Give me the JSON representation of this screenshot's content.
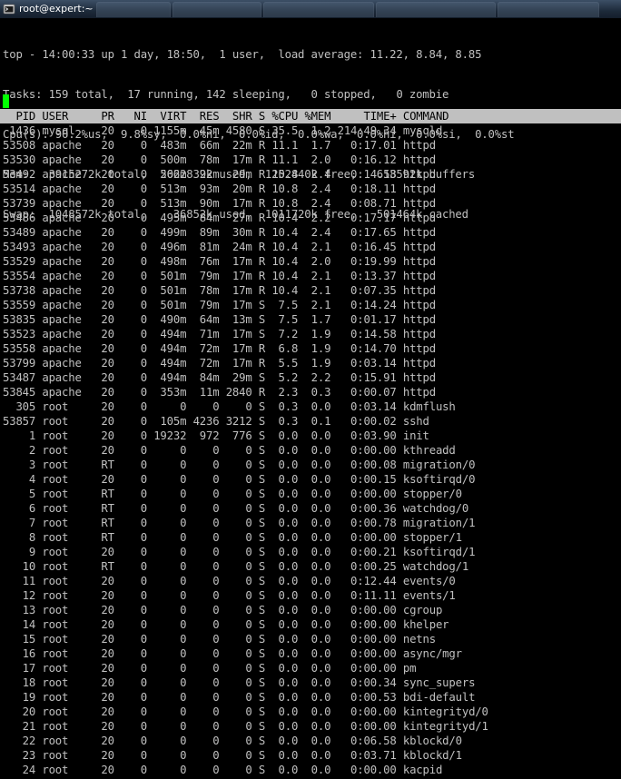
{
  "window": {
    "title": "root@expert:~"
  },
  "summary": [
    "top - 14:00:33 up 1 day, 18:50,  1 user,  load average: 11.22, 8.84, 8.85",
    "Tasks: 159 total,  17 running, 142 sleeping,   0 stopped,   0 zombie",
    "Cpu(s): 90.2%us,  9.8%sy,  0.0%ni,  0.0%id,  0.0%wa,  0.0%hi,  0.0%si,  0.0%st",
    "Mem:   3915272k total,  2662832k used,  1252440k free,   613592k buffers",
    "Swap:  1048572k total,    36852k used,  1011720k free,   501464k cached"
  ],
  "table": {
    "columns": [
      "PID",
      "USER",
      "PR",
      "NI",
      "VIRT",
      "RES",
      "SHR",
      "S",
      "%CPU",
      "%MEM",
      "TIME+",
      "COMMAND"
    ],
    "rows": [
      [
        "1436",
        "mysql",
        "20",
        "0",
        "1155m",
        "45m",
        "4580",
        "S",
        "35.5",
        "1.2",
        "214:49.34",
        "mysqld"
      ],
      [
        "53508",
        "apache",
        "20",
        "0",
        "483m",
        "66m",
        "22m",
        "R",
        "11.1",
        "1.7",
        "0:17.01",
        "httpd"
      ],
      [
        "53530",
        "apache",
        "20",
        "0",
        "500m",
        "78m",
        "17m",
        "R",
        "11.1",
        "2.0",
        "0:16.12",
        "httpd"
      ],
      [
        "53492",
        "apache",
        "20",
        "0",
        "502m",
        "92m",
        "29m",
        "R",
        "10.8",
        "2.4",
        "0:14.58",
        "httpd"
      ],
      [
        "53514",
        "apache",
        "20",
        "0",
        "513m",
        "93m",
        "20m",
        "R",
        "10.8",
        "2.4",
        "0:18.11",
        "httpd"
      ],
      [
        "53739",
        "apache",
        "20",
        "0",
        "513m",
        "90m",
        "17m",
        "R",
        "10.8",
        "2.4",
        "0:08.71",
        "httpd"
      ],
      [
        "53486",
        "apache",
        "20",
        "0",
        "495m",
        "84m",
        "27m",
        "R",
        "10.4",
        "2.2",
        "0:17.17",
        "httpd"
      ],
      [
        "53489",
        "apache",
        "20",
        "0",
        "499m",
        "89m",
        "30m",
        "R",
        "10.4",
        "2.4",
        "0:17.65",
        "httpd"
      ],
      [
        "53493",
        "apache",
        "20",
        "0",
        "496m",
        "81m",
        "24m",
        "R",
        "10.4",
        "2.1",
        "0:16.45",
        "httpd"
      ],
      [
        "53529",
        "apache",
        "20",
        "0",
        "498m",
        "76m",
        "17m",
        "R",
        "10.4",
        "2.0",
        "0:19.99",
        "httpd"
      ],
      [
        "53554",
        "apache",
        "20",
        "0",
        "501m",
        "79m",
        "17m",
        "R",
        "10.4",
        "2.1",
        "0:13.37",
        "httpd"
      ],
      [
        "53738",
        "apache",
        "20",
        "0",
        "501m",
        "78m",
        "17m",
        "R",
        "10.4",
        "2.1",
        "0:07.35",
        "httpd"
      ],
      [
        "53559",
        "apache",
        "20",
        "0",
        "501m",
        "79m",
        "17m",
        "S",
        "7.5",
        "2.1",
        "0:14.24",
        "httpd"
      ],
      [
        "53835",
        "apache",
        "20",
        "0",
        "490m",
        "64m",
        "13m",
        "S",
        "7.5",
        "1.7",
        "0:01.17",
        "httpd"
      ],
      [
        "53523",
        "apache",
        "20",
        "0",
        "494m",
        "71m",
        "17m",
        "S",
        "7.2",
        "1.9",
        "0:14.58",
        "httpd"
      ],
      [
        "53558",
        "apache",
        "20",
        "0",
        "494m",
        "72m",
        "17m",
        "R",
        "6.8",
        "1.9",
        "0:14.70",
        "httpd"
      ],
      [
        "53799",
        "apache",
        "20",
        "0",
        "494m",
        "72m",
        "17m",
        "R",
        "5.5",
        "1.9",
        "0:03.14",
        "httpd"
      ],
      [
        "53487",
        "apache",
        "20",
        "0",
        "494m",
        "84m",
        "29m",
        "S",
        "5.2",
        "2.2",
        "0:15.91",
        "httpd"
      ],
      [
        "53845",
        "apache",
        "20",
        "0",
        "353m",
        "11m",
        "2840",
        "R",
        "2.3",
        "0.3",
        "0:00.07",
        "httpd"
      ],
      [
        "305",
        "root",
        "20",
        "0",
        "0",
        "0",
        "0",
        "S",
        "0.3",
        "0.0",
        "0:03.14",
        "kdmflush"
      ],
      [
        "53857",
        "root",
        "20",
        "0",
        "105m",
        "4236",
        "3212",
        "S",
        "0.3",
        "0.1",
        "0:00.02",
        "sshd"
      ],
      [
        "1",
        "root",
        "20",
        "0",
        "19232",
        "972",
        "776",
        "S",
        "0.0",
        "0.0",
        "0:03.90",
        "init"
      ],
      [
        "2",
        "root",
        "20",
        "0",
        "0",
        "0",
        "0",
        "S",
        "0.0",
        "0.0",
        "0:00.00",
        "kthreadd"
      ],
      [
        "3",
        "root",
        "RT",
        "0",
        "0",
        "0",
        "0",
        "S",
        "0.0",
        "0.0",
        "0:00.08",
        "migration/0"
      ],
      [
        "4",
        "root",
        "20",
        "0",
        "0",
        "0",
        "0",
        "S",
        "0.0",
        "0.0",
        "0:00.15",
        "ksoftirqd/0"
      ],
      [
        "5",
        "root",
        "RT",
        "0",
        "0",
        "0",
        "0",
        "S",
        "0.0",
        "0.0",
        "0:00.00",
        "stopper/0"
      ],
      [
        "6",
        "root",
        "RT",
        "0",
        "0",
        "0",
        "0",
        "S",
        "0.0",
        "0.0",
        "0:00.36",
        "watchdog/0"
      ],
      [
        "7",
        "root",
        "RT",
        "0",
        "0",
        "0",
        "0",
        "S",
        "0.0",
        "0.0",
        "0:00.78",
        "migration/1"
      ],
      [
        "8",
        "root",
        "RT",
        "0",
        "0",
        "0",
        "0",
        "S",
        "0.0",
        "0.0",
        "0:00.00",
        "stopper/1"
      ],
      [
        "9",
        "root",
        "20",
        "0",
        "0",
        "0",
        "0",
        "S",
        "0.0",
        "0.0",
        "0:00.21",
        "ksoftirqd/1"
      ],
      [
        "10",
        "root",
        "RT",
        "0",
        "0",
        "0",
        "0",
        "S",
        "0.0",
        "0.0",
        "0:00.25",
        "watchdog/1"
      ],
      [
        "11",
        "root",
        "20",
        "0",
        "0",
        "0",
        "0",
        "S",
        "0.0",
        "0.0",
        "0:12.44",
        "events/0"
      ],
      [
        "12",
        "root",
        "20",
        "0",
        "0",
        "0",
        "0",
        "S",
        "0.0",
        "0.0",
        "0:11.11",
        "events/1"
      ],
      [
        "13",
        "root",
        "20",
        "0",
        "0",
        "0",
        "0",
        "S",
        "0.0",
        "0.0",
        "0:00.00",
        "cgroup"
      ],
      [
        "14",
        "root",
        "20",
        "0",
        "0",
        "0",
        "0",
        "S",
        "0.0",
        "0.0",
        "0:00.00",
        "khelper"
      ],
      [
        "15",
        "root",
        "20",
        "0",
        "0",
        "0",
        "0",
        "S",
        "0.0",
        "0.0",
        "0:00.00",
        "netns"
      ],
      [
        "16",
        "root",
        "20",
        "0",
        "0",
        "0",
        "0",
        "S",
        "0.0",
        "0.0",
        "0:00.00",
        "async/mgr"
      ],
      [
        "17",
        "root",
        "20",
        "0",
        "0",
        "0",
        "0",
        "S",
        "0.0",
        "0.0",
        "0:00.00",
        "pm"
      ],
      [
        "18",
        "root",
        "20",
        "0",
        "0",
        "0",
        "0",
        "S",
        "0.0",
        "0.0",
        "0:00.34",
        "sync_supers"
      ],
      [
        "19",
        "root",
        "20",
        "0",
        "0",
        "0",
        "0",
        "S",
        "0.0",
        "0.0",
        "0:00.53",
        "bdi-default"
      ],
      [
        "20",
        "root",
        "20",
        "0",
        "0",
        "0",
        "0",
        "S",
        "0.0",
        "0.0",
        "0:00.00",
        "kintegrityd/0"
      ],
      [
        "21",
        "root",
        "20",
        "0",
        "0",
        "0",
        "0",
        "S",
        "0.0",
        "0.0",
        "0:00.00",
        "kintegrityd/1"
      ],
      [
        "22",
        "root",
        "20",
        "0",
        "0",
        "0",
        "0",
        "S",
        "0.0",
        "0.0",
        "0:06.58",
        "kblockd/0"
      ],
      [
        "23",
        "root",
        "20",
        "0",
        "0",
        "0",
        "0",
        "S",
        "0.0",
        "0.0",
        "0:03.71",
        "kblockd/1"
      ],
      [
        "24",
        "root",
        "20",
        "0",
        "0",
        "0",
        "0",
        "S",
        "0.0",
        "0.0",
        "0:00.00",
        "kacpid"
      ]
    ]
  },
  "colors": {
    "terminal_bg": "#000000",
    "terminal_fg": "#c0c0c0",
    "header_bar_bg": "#c0c0c0",
    "header_bar_fg": "#000000",
    "cursor": "#00ff00"
  },
  "icons": {
    "title_icon": "terminal-window-icon"
  }
}
